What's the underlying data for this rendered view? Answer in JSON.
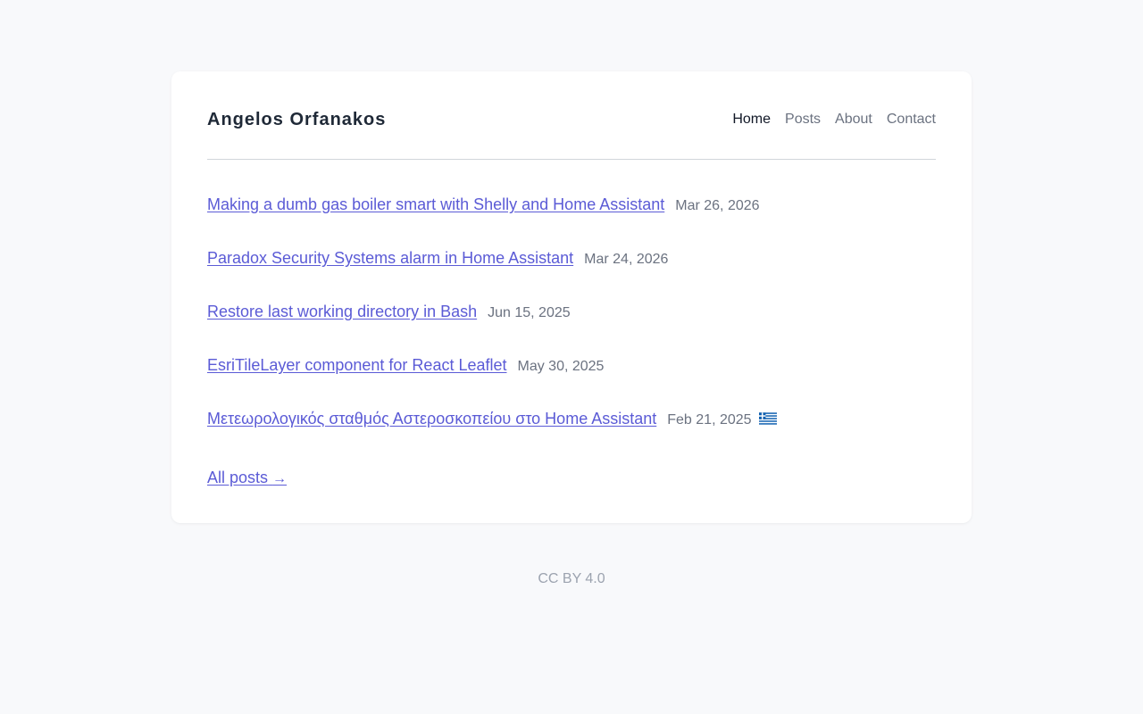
{
  "site": {
    "title": "Angelos Orfanakos"
  },
  "nav": {
    "items": [
      {
        "label": "Home",
        "active": true
      },
      {
        "label": "Posts"
      },
      {
        "label": "About"
      },
      {
        "label": "Contact"
      }
    ]
  },
  "posts": [
    {
      "title": "Making a dumb gas boiler smart with Shelly and Home Assistant",
      "date": "Mar 26, 2026"
    },
    {
      "title": "Paradox Security Systems alarm in Home Assistant",
      "date": "Mar 24, 2026"
    },
    {
      "title": "Restore last working directory in Bash",
      "date": "Jun 15, 2025"
    },
    {
      "title": "EsriTileLayer component for React Leaflet",
      "date": "May 30, 2025"
    },
    {
      "title": "Μετεωρολογικός σταθμός Αστεροσκοπείου στο Home Assistant",
      "date": "Feb 21, 2025",
      "flag": "greek-flag-icon"
    }
  ],
  "all_posts": {
    "label": "All posts",
    "arrow": "→"
  },
  "footer": {
    "license": "CC BY 4.0"
  },
  "colors": {
    "link": "#5b5bd6",
    "muted": "#6b7280",
    "background": "#f8f9fb"
  }
}
